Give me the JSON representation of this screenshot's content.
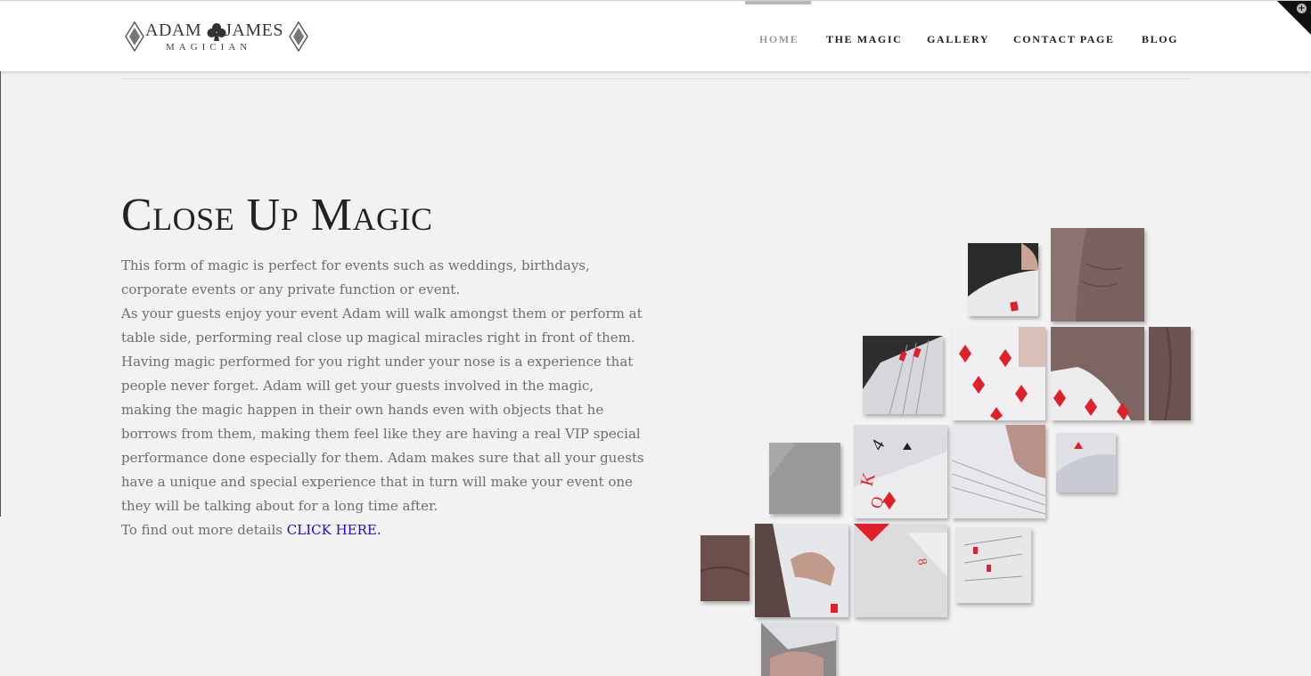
{
  "logo": {
    "name": "ADAM",
    "name2": "JAMES",
    "subtitle": "MAGICIAN"
  },
  "nav": {
    "items": [
      {
        "label": "HOME",
        "active": true
      },
      {
        "label": "THE MAGIC",
        "active": false
      },
      {
        "label": "GALLERY",
        "active": false
      },
      {
        "label": "CONTACT PAGE",
        "active": false
      },
      {
        "label": "BLOG",
        "active": false
      }
    ]
  },
  "main": {
    "title": "Close Up Magic",
    "paragraph1": "This form of magic is perfect for events such as weddings, birthdays, corporate events or any private function or event.",
    "paragraph2": "As your guests enjoy your event Adam will walk amongst them or perform at table side, performing real close up magical miracles right in front of them. Having magic performed for you right under your nose is a experience that people never forget. Adam will get your guests involved in the magic, making the magic happen in their own hands even with objects that he borrows from them, making them feel like they are having a real VIP special performance done especially for them. Adam makes sure that all your guests have a unique and special experience that in turn will make your event one they will be talking about for a long time after.",
    "cta_prefix": "To find out more details",
    "cta_link": "CLICK HERE."
  },
  "colors": {
    "accent_link": "#1a0dcc",
    "card_red": "#e0202a",
    "bg": "#f2f2f2"
  }
}
